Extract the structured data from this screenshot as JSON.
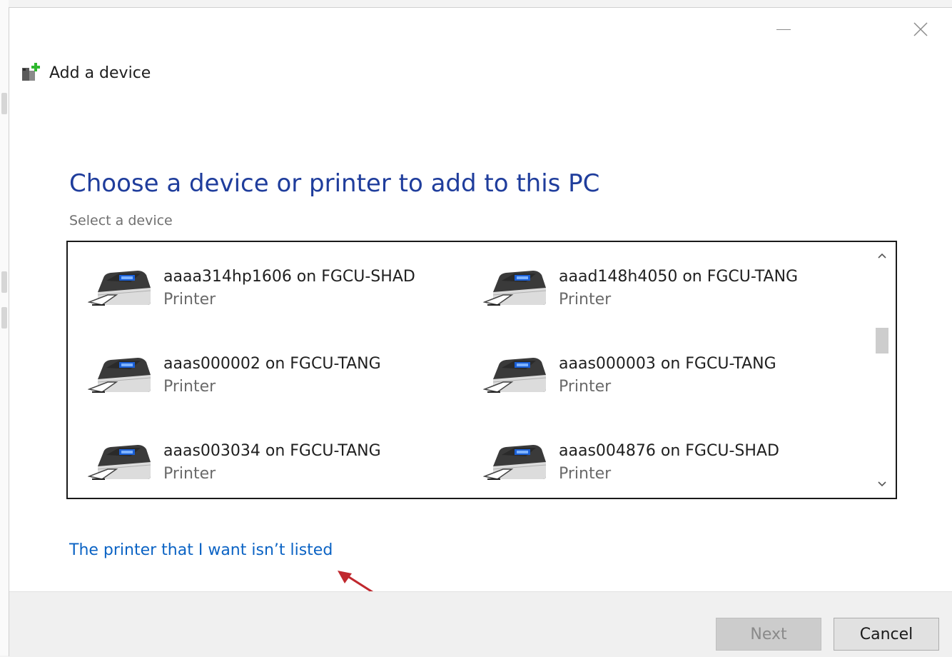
{
  "window": {
    "title": "Add a device",
    "minimize_icon": "minimize-icon",
    "close_icon": "close-icon"
  },
  "heading": "Choose a device or printer to add to this PC",
  "subheading": "Select a device",
  "devices": [
    {
      "name": "aaaa314hp1606 on FGCU-SHAD",
      "type": "Printer",
      "icon": "printer-icon"
    },
    {
      "name": "aaad148h4050 on FGCU-TANG",
      "type": "Printer",
      "icon": "printer-icon"
    },
    {
      "name": "aaas000002 on FGCU-TANG",
      "type": "Printer",
      "icon": "printer-icon"
    },
    {
      "name": "aaas000003 on FGCU-TANG",
      "type": "Printer",
      "icon": "printer-icon"
    },
    {
      "name": "aaas003034 on FGCU-TANG",
      "type": "Printer",
      "icon": "printer-icon"
    },
    {
      "name": "aaas004876 on FGCU-SHAD",
      "type": "Printer",
      "icon": "printer-icon"
    }
  ],
  "link": "The printer that I want isn’t listed",
  "buttons": {
    "next": "Next",
    "cancel": "Cancel"
  },
  "colors": {
    "heading": "#1f3d9c",
    "link": "#0b63c4",
    "annotation_arrow": "#c0282e"
  }
}
